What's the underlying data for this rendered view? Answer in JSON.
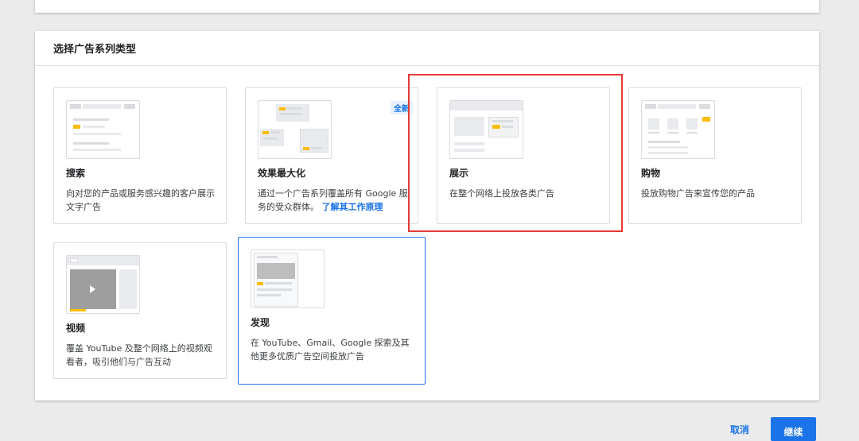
{
  "section_title": "选择广告系列类型",
  "campaign_types": [
    {
      "title": "搜索",
      "desc": "向对您的产品或服务感兴趣的客户展示文字广告",
      "link": ""
    },
    {
      "title": "效果最大化",
      "desc": "通过一个广告系列覆盖所有 Google 服务的受众群体。",
      "link": "了解其工作原理",
      "badge": "全新"
    },
    {
      "title": "展示",
      "desc": "在整个网络上投放各类广告",
      "link": ""
    },
    {
      "title": "购物",
      "desc": "投放购物广告来宣传您的产品",
      "link": ""
    },
    {
      "title": "视频",
      "desc": "覆盖 YouTube 及整个网络上的视频观看者，吸引他们与广告互动",
      "link": ""
    },
    {
      "title": "发现",
      "desc": "在 YouTube、Gmail、Google 探索及其他更多优质广告空间投放广告",
      "link": ""
    }
  ],
  "selected": "发现",
  "highlighted": "展示",
  "actions": {
    "cancel": "取消",
    "continue": "继续"
  },
  "colors": {
    "accent": "#1a73e8",
    "highlight": "#e53935",
    "ad_marker": "#fbbc04"
  }
}
